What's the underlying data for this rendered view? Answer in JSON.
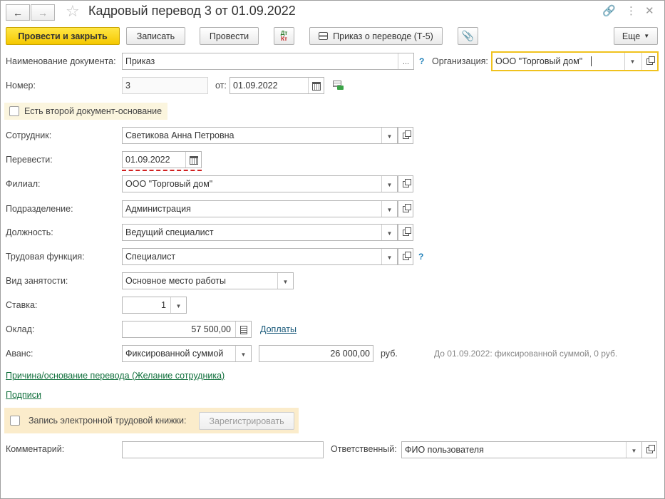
{
  "window": {
    "title": "Кадровый перевод 3 от 01.09.2022"
  },
  "toolbar": {
    "post_close_label": "Провести и закрыть",
    "save_label": "Записать",
    "post_label": "Провести",
    "dtkt_label_top": "Дт",
    "dtkt_label_bottom": "Кт",
    "print_label": "Приказ о переводе (Т-5)",
    "more_label": "Еще"
  },
  "form": {
    "doc_name_label": "Наименование документа:",
    "doc_name_value": "Приказ",
    "doc_name_dots": "...",
    "org_label": "Организация:",
    "org_value": "ООО \"Торговый дом\"",
    "number_label": "Номер:",
    "number_value": "3",
    "from_label": "от:",
    "from_value": "01.09.2022",
    "second_doc_label": "Есть второй документ-основание",
    "employee_label": "Сотрудник:",
    "employee_value": "Светикова Анна Петровна",
    "transfer_label": "Перевести:",
    "transfer_value": "01.09.2022",
    "branch_label": "Филиал:",
    "branch_value": "ООО \"Торговый дом\"",
    "dept_label": "Подразделение:",
    "dept_value": "Администрация",
    "position_label": "Должность:",
    "position_value": "Ведущий специалист",
    "labor_func_label": "Трудовая функция:",
    "labor_func_value": "Специалист",
    "employment_label": "Вид занятости:",
    "employment_value": "Основное место работы",
    "rate_label": "Ставка:",
    "rate_value": "1",
    "salary_label": "Оклад:",
    "salary_value": "57 500,00",
    "allowances_link": "Доплаты",
    "advance_label": "Аванс:",
    "advance_method_value": "Фиксированной суммой",
    "advance_amount_value": "26 000,00",
    "advance_unit": "руб.",
    "advance_hint": "До 01.09.2022: фиксированной суммой, 0 руб.",
    "reason_link": "Причина/основание перевода (Желание сотрудника)",
    "signatures_link": "Подписи",
    "etk_label": "Запись электронной трудовой книжки:",
    "register_label": "Зарегистрировать",
    "comment_label": "Комментарий:",
    "comment_value": "",
    "responsible_label": "Ответственный:",
    "responsible_value": "ФИО пользователя",
    "help_mark": "?"
  },
  "colors": {
    "primary_button": "#f5c800",
    "focus_border": "#f0c21e",
    "link_green": "#0e6e3a",
    "link_blue": "#1a5a7a",
    "error_underline": "#d11f1f",
    "highlight_bg": "#fbeccb"
  }
}
